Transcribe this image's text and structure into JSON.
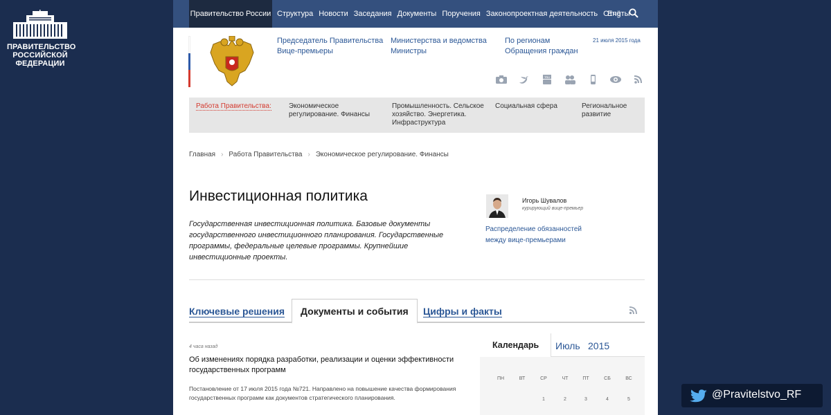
{
  "side_emblem": {
    "label_lines": [
      "ПРАВИТЕЛЬСТВО",
      "РОССИЙСКОЙ",
      "ФЕДЕРАЦИИ"
    ]
  },
  "topnav": {
    "brand": "Правительство России",
    "items": [
      "Структура",
      "Новости",
      "Заседания",
      "Документы",
      "Поручения",
      "Законопроектная деятельность",
      "Отчёты"
    ],
    "lang": "Eng"
  },
  "header": {
    "links_col1": [
      "Председатель Правительства",
      "Вице-премьеры"
    ],
    "links_col2": [
      "Министерства и ведомства",
      "Министры"
    ],
    "links_col3": [
      "По регионам",
      "Обращения граждан"
    ],
    "date": "21 июля 2015 года",
    "social_icons": [
      "camera-icon",
      "twitter-icon",
      "youtube-icon",
      "users-icon",
      "mobile-icon",
      "eye-icon",
      "rss-icon"
    ]
  },
  "workbar": {
    "label": "Работа Правительства:",
    "items": [
      [
        "Экономическое",
        "регулирование. Финансы"
      ],
      [
        "Промышленность. Сельское",
        "хозяйство. Энергетика.",
        "Инфраструктура"
      ],
      [
        "Социальная сфера"
      ],
      [
        "Региональное",
        "развитие"
      ]
    ]
  },
  "breadcrumb": [
    "Главная",
    "Работа Правительства",
    "Экономическое регулирование. Финансы"
  ],
  "page": {
    "title": "Инвестиционная политика",
    "description": "Государственная инвестиционная политика. Базовые документы государственного инвестиционного планирования. Государственные программы, федеральные целевые программы. Крупнейшие инвестиционные проекты."
  },
  "person": {
    "name": "Игорь Шувалов",
    "role": "курирующий вице-премьер",
    "duties_lines": [
      "Распределение обязанностей",
      "между вице-премьерами"
    ]
  },
  "tabs": [
    "Ключевые решения",
    "Документы и события",
    "Цифры и факты"
  ],
  "news": {
    "time_ago": "4 часа назад",
    "title": "Об изменениях порядка разработки, реализации и оценки эффективности государственных программ",
    "body": "Постановление от 17 июля 2015 года №721. Направлено на повышение качества формирования государственных программ как документов стратегического планирования."
  },
  "calendar": {
    "label": "Календарь",
    "month": "Июль",
    "year": "2015",
    "weekdays": [
      "ПН",
      "ВТ",
      "СР",
      "ЧТ",
      "ПТ",
      "СБ",
      "ВС"
    ],
    "first_row_days": [
      "1",
      "2",
      "3",
      "4",
      "5"
    ]
  },
  "twitter": {
    "handle": "@Pravitelstvo_RF"
  },
  "colors": {
    "sidebar_bg": "#1b2d4f",
    "nav_bg": "#34507e",
    "link": "#2b5796",
    "accent_red": "#d43a2f"
  }
}
